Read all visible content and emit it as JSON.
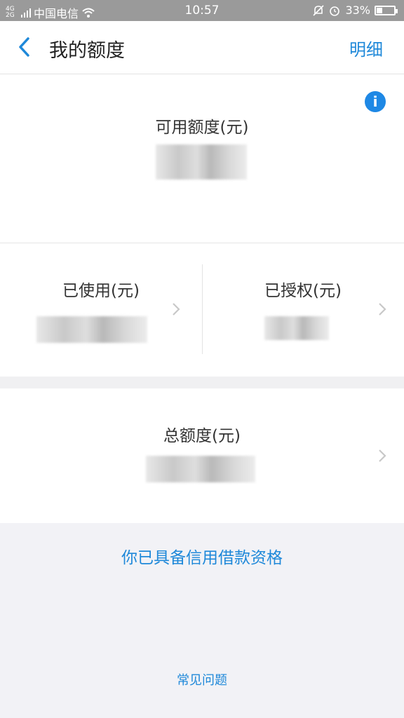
{
  "status_bar": {
    "network_badge": "4G 2G",
    "carrier": "中国电信",
    "time": "10:57",
    "battery_percent": "33%",
    "battery_level": 0.33
  },
  "nav": {
    "title": "我的额度",
    "detail_link": "明细"
  },
  "available": {
    "label": "可用额度(元)"
  },
  "used": {
    "label": "已使用(元)"
  },
  "authorized": {
    "label": "已授权(元)"
  },
  "total": {
    "label": "总额度(元)"
  },
  "qualify_text": "你已具备信用借款资格",
  "faq_link": "常见问题",
  "colors": {
    "accent": "#1e88d9",
    "status_bar": "#9a9a9a",
    "background": "#f2f2f6"
  }
}
